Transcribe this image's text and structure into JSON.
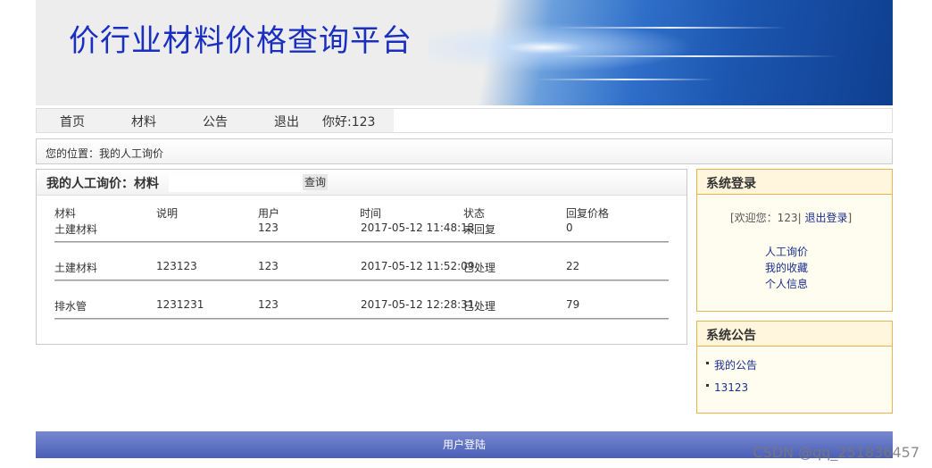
{
  "banner": {
    "title": "价行业材料价格查询平台"
  },
  "nav": {
    "items": [
      {
        "label": "首页"
      },
      {
        "label": "材料"
      },
      {
        "label": "公告"
      },
      {
        "label": "退出"
      }
    ],
    "greeting": "你好:123"
  },
  "breadcrumb": "您的位置：我的人工询价",
  "inquiry": {
    "title": "我的人工询价：材料",
    "search_placeholder": "",
    "search_button": "查询",
    "columns": [
      "材料",
      "说明",
      "用户",
      "时间",
      "状态",
      "回复价格"
    ],
    "rows": [
      {
        "material": "土建材料",
        "desc": "",
        "user": "123",
        "time": "2017-05-12 11:48:13",
        "status": "未回复",
        "price": "0"
      },
      {
        "material": "土建材料",
        "desc": "123123",
        "user": "123",
        "time": "2017-05-12 11:52:09",
        "status": "已处理",
        "price": "22"
      },
      {
        "material": "排水管",
        "desc": "1231231",
        "user": "123",
        "time": "2017-05-12 12:28:31",
        "status": "已处理",
        "price": "79"
      }
    ]
  },
  "login_box": {
    "title": "系统登录",
    "welcome_prefix": "[欢迎您：123|",
    "logout_label": "退出登录",
    "welcome_suffix": "]",
    "links": [
      "人工询价",
      "我的收藏",
      "个人信息"
    ]
  },
  "notice_box": {
    "title": "系统公告",
    "items": [
      "我的公告",
      "13123"
    ]
  },
  "footer": {
    "label": "用户登陆"
  },
  "watermark": "CSDN @qq_251836457"
}
